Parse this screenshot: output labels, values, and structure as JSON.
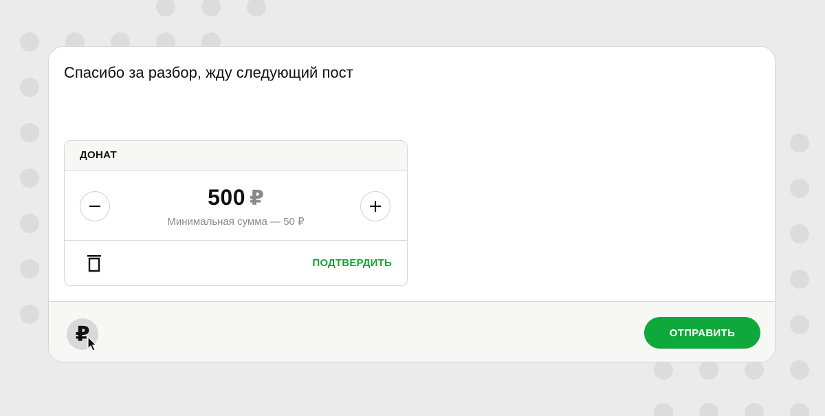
{
  "composer": {
    "message_text": "Спасибо за разбор, жду следующий пост"
  },
  "donate": {
    "title": "ДОНАТ",
    "amount": "500",
    "currency": "₽",
    "min_note": "Минимальная сумма — 50 ₽",
    "confirm_label": "ПОДТВЕРДИТЬ"
  },
  "toolbar": {
    "ruble_symbol": "₽",
    "send_label": "ОТПРАВИТЬ"
  },
  "colors": {
    "accent_green": "#0fa83a",
    "confirm_green": "#1aa13a",
    "background": "#ebebeb"
  },
  "icons": [
    "minus-icon",
    "plus-icon",
    "trash-icon",
    "ruble-icon",
    "mouse-cursor-icon"
  ]
}
